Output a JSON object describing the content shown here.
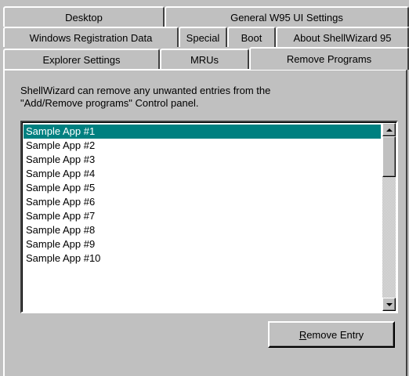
{
  "tabs": {
    "row1": [
      {
        "label": "Desktop"
      },
      {
        "label": "General W95 UI Settings"
      }
    ],
    "row2": [
      {
        "label": "Windows Registration Data"
      },
      {
        "label": "Special"
      },
      {
        "label": "Boot"
      },
      {
        "label": "About ShellWizard 95"
      }
    ],
    "row3": [
      {
        "label": "Explorer Settings"
      },
      {
        "label": "MRUs"
      },
      {
        "label": "Remove Programs",
        "active": true
      }
    ]
  },
  "panel": {
    "description_line1": "ShellWizard can remove any unwanted entries from the",
    "description_line2": "\"Add/Remove programs\" Control panel.",
    "list": {
      "selected_index": 0,
      "items": [
        "Sample App #1",
        "Sample App #2",
        "Sample App #3",
        "Sample App #4",
        "Sample App #5",
        "Sample App #6",
        "Sample App #7",
        "Sample App #8",
        "Sample App #9",
        "Sample App #10"
      ]
    },
    "remove_button": {
      "mnemonic": "R",
      "rest": "emove Entry"
    }
  },
  "colors": {
    "face": "#c0c0c0",
    "selection": "#008080",
    "selection_text": "#ffffff"
  }
}
